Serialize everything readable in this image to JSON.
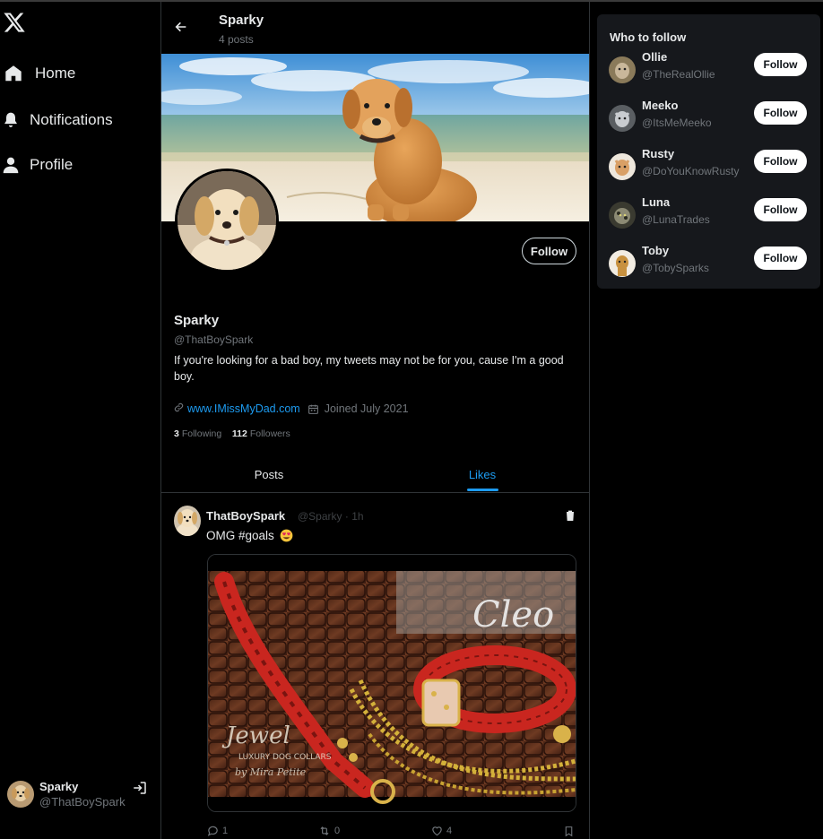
{
  "brand": {
    "logo_icon": "x-logo-icon"
  },
  "nav": {
    "items": [
      {
        "label": "Home",
        "icon": "home-icon"
      },
      {
        "label": "Notifications",
        "icon": "bell-icon"
      },
      {
        "label": "Profile",
        "icon": "person-icon"
      }
    ]
  },
  "account": {
    "name": "Sparky",
    "handle": "@ThatBoySpark",
    "logout_icon": "logout-icon"
  },
  "header": {
    "title": "Sparky",
    "subtitle": "4 posts",
    "back_icon": "arrow-left-icon"
  },
  "profile": {
    "name": "Sparky",
    "handle": "@ThatBoySpark",
    "bio": "If you're looking for a bad boy, my tweets may not be for you, cause I'm a good boy.",
    "website": "www.IMissMyDad.com",
    "joined": "Joined July 2021",
    "following_count": "3",
    "following_label": "Following",
    "followers_count": "112",
    "followers_label": "Followers",
    "follow_label": "Follow"
  },
  "tabs": [
    {
      "label": "Posts",
      "active": false
    },
    {
      "label": "Likes",
      "active": true
    }
  ],
  "post": {
    "author": "ThatBoySpark",
    "meta": "@Sparky · 1h",
    "text": "OMG #goals",
    "emoji": "heart-eyes-emoji",
    "media_text": {
      "brand_script": "Cleo",
      "logo_script": "Jewel",
      "logo_sub": "LUXURY DOG COLLARS",
      "logo_byline": "by Mira Petite"
    },
    "replies": "1",
    "reposts": "0",
    "likes": "4"
  },
  "who_to_follow": {
    "title": "Who to follow",
    "button_label": "Follow",
    "users": [
      {
        "name": "Ollie",
        "handle": "@TheRealOllie",
        "avatar_color": "#8a7a5a"
      },
      {
        "name": "Meeko",
        "handle": "@ItsMeMeeko",
        "avatar_color": "#9aa0a6"
      },
      {
        "name": "Rusty",
        "handle": "@DoYouKnowRusty",
        "avatar_color": "#d9a066"
      },
      {
        "name": "Luna",
        "handle": "@LunaTrades",
        "avatar_color": "#6b6b5a"
      },
      {
        "name": "Toby",
        "handle": "@TobySparks",
        "avatar_color": "#c8913f"
      }
    ]
  },
  "colors": {
    "accent": "#1d9bf0",
    "background": "#000000",
    "panel": "#16181c",
    "muted": "#71767b"
  }
}
